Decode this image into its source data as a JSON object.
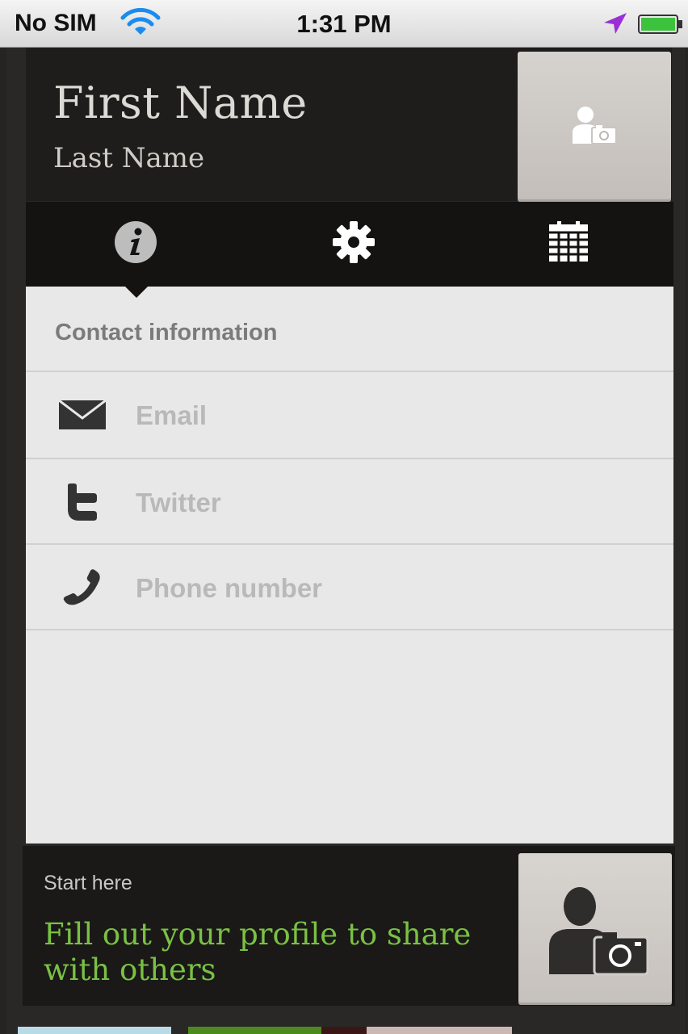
{
  "status_bar": {
    "carrier": "No SIM",
    "time": "1:31 PM",
    "icons": [
      "wifi-icon",
      "location-arrow-icon",
      "battery-icon"
    ]
  },
  "profile": {
    "first_name": "First Name",
    "last_name": "Last Name",
    "photo_button_icon": "person-camera-icon"
  },
  "tabs": [
    {
      "icon": "info-icon",
      "selected": true
    },
    {
      "icon": "gear-icon",
      "selected": false
    },
    {
      "icon": "calendar-icon",
      "selected": false
    }
  ],
  "contact": {
    "section_title": "Contact information",
    "fields": [
      {
        "icon": "envelope-icon",
        "placeholder": "Email",
        "value": ""
      },
      {
        "icon": "twitter-icon",
        "placeholder": "Twitter",
        "value": ""
      },
      {
        "icon": "phone-icon",
        "placeholder": "Phone number",
        "value": ""
      }
    ]
  },
  "footer": {
    "kicker": "Start here",
    "message": "Fill out your profile to share with others",
    "photo_button_icon": "person-camera-icon"
  },
  "colors": {
    "accent_green": "#7ac143",
    "panel_bg": "#e8e8e8",
    "dark_bg": "#1e1d1c"
  }
}
